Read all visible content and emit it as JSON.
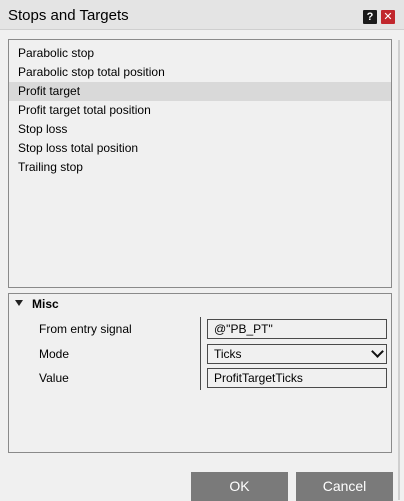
{
  "window": {
    "title": "Stops and Targets",
    "help_label": "?",
    "close_label": "✕"
  },
  "list": {
    "items": [
      {
        "label": "Parabolic stop",
        "selected": false
      },
      {
        "label": "Parabolic stop total position",
        "selected": false
      },
      {
        "label": "Profit target",
        "selected": true
      },
      {
        "label": "Profit target total position",
        "selected": false
      },
      {
        "label": "Stop loss",
        "selected": false
      },
      {
        "label": "Stop loss total position",
        "selected": false
      },
      {
        "label": "Trailing stop",
        "selected": false
      }
    ]
  },
  "properties": {
    "category": "Misc",
    "rows": [
      {
        "label": "From entry signal",
        "value": "@\"PB_PT\""
      },
      {
        "label": "Mode",
        "value": "Ticks"
      },
      {
        "label": "Value",
        "value": "ProfitTargetTicks"
      }
    ]
  },
  "buttons": {
    "ok": "OK",
    "cancel": "Cancel"
  },
  "colors": {
    "selected_row": "#d9d9d9",
    "button_bg": "#7a7a7a",
    "close_bg": "#c1272d"
  }
}
